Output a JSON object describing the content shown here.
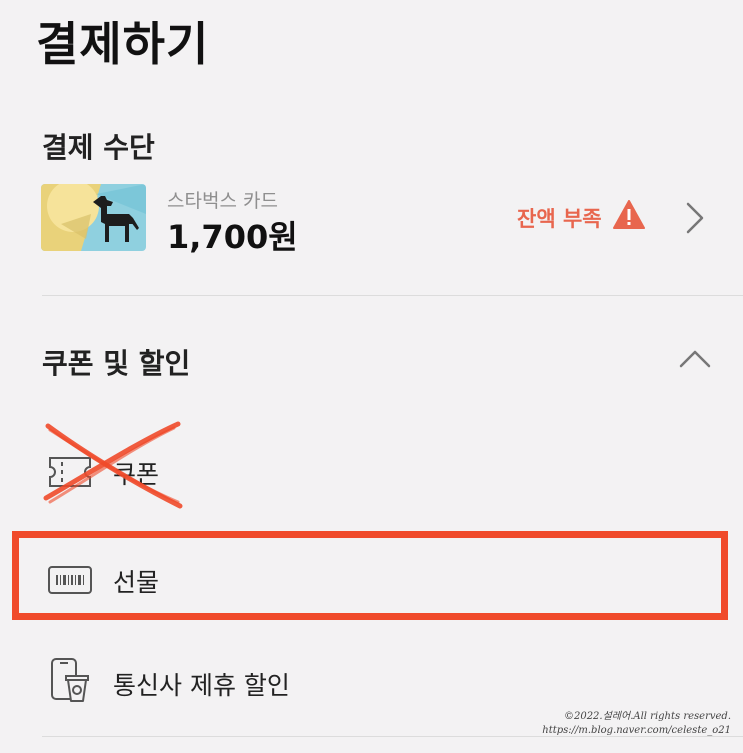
{
  "header": {
    "title": "결제하기"
  },
  "payment": {
    "section_title": "결제 수단",
    "card": {
      "name": "스타벅스 카드",
      "balance": "1,700원",
      "status": "잔액 부족",
      "status_color": "#e8664e",
      "status_icon": "warning-triangle-icon",
      "chevron_icon": "chevron-right-icon"
    }
  },
  "coupons": {
    "section_title": "쿠폰 및 할인",
    "collapse_icon": "chevron-up-icon",
    "options": [
      {
        "label": "쿠폰",
        "icon": "ticket-icon"
      },
      {
        "label": "선물",
        "icon": "gift-card-icon"
      },
      {
        "label": "통신사 제휴 할인",
        "icon": "phone-cup-icon"
      }
    ]
  },
  "annotations": {
    "highlight_color": "#f04a2a",
    "strike_color": "#f04a2a"
  },
  "watermark": {
    "line1": "©2022.설레어.All rights reserved.",
    "line2": "https://m.blog.naver.com/celeste_o21"
  }
}
